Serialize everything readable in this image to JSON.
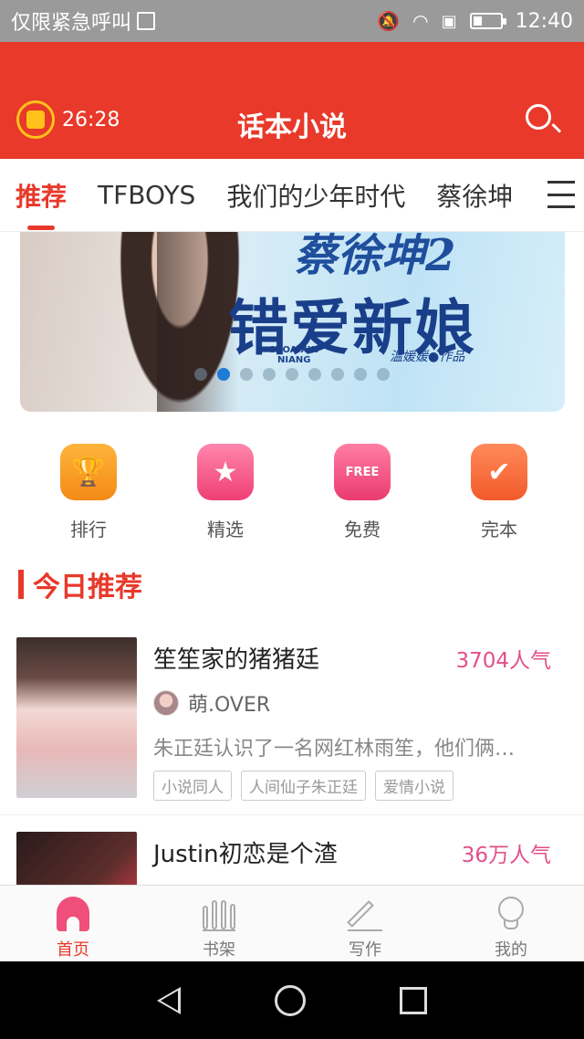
{
  "status_bar": {
    "carrier": "仅限紧急呼叫",
    "time": "12:40"
  },
  "header": {
    "timer": "26:28",
    "title": "话本小说"
  },
  "tabs": [
    {
      "label": "推荐",
      "active": true
    },
    {
      "label": "TFBOYS",
      "active": false
    },
    {
      "label": "我们的少年时代",
      "active": false
    },
    {
      "label": "蔡徐坤",
      "active": false
    }
  ],
  "banner": {
    "title_line1": "蔡徐坤2",
    "title_line2": "错爱新娘",
    "pinyin_line1": "CUOAIXIN",
    "pinyin_line2": "NIANG",
    "author": "温媛媛●作品",
    "active_page": 2,
    "page_count": 9
  },
  "quick_links": [
    {
      "label": "排行",
      "icon": "trophy-icon"
    },
    {
      "label": "精选",
      "icon": "star-icon"
    },
    {
      "label": "免费",
      "icon": "free-tag-icon",
      "badge": "FREE"
    },
    {
      "label": "完本",
      "icon": "checked-book-icon"
    }
  ],
  "section": {
    "title": "今日推荐"
  },
  "books": [
    {
      "title": "笙笙家的猪猪廷",
      "popularity": "3704人气",
      "author": "萌.OVER",
      "description": "朱正廷认识了一名网红林雨笙，他们俩…",
      "tags": [
        "小说同人",
        "人间仙子朱正廷",
        "爱情小说"
      ]
    },
    {
      "title": "Justin初恋是个渣",
      "popularity": "36万人气"
    }
  ],
  "bottom_nav": [
    {
      "label": "首页",
      "icon": "home-icon",
      "active": true
    },
    {
      "label": "书架",
      "icon": "bookshelf-icon",
      "active": false
    },
    {
      "label": "写作",
      "icon": "pen-icon",
      "active": false
    },
    {
      "label": "我的",
      "icon": "profile-icon",
      "active": false
    }
  ],
  "colors": {
    "brand": "#e8392a",
    "popularity": "#e2508a",
    "active_dot": "#1f7bd8"
  }
}
